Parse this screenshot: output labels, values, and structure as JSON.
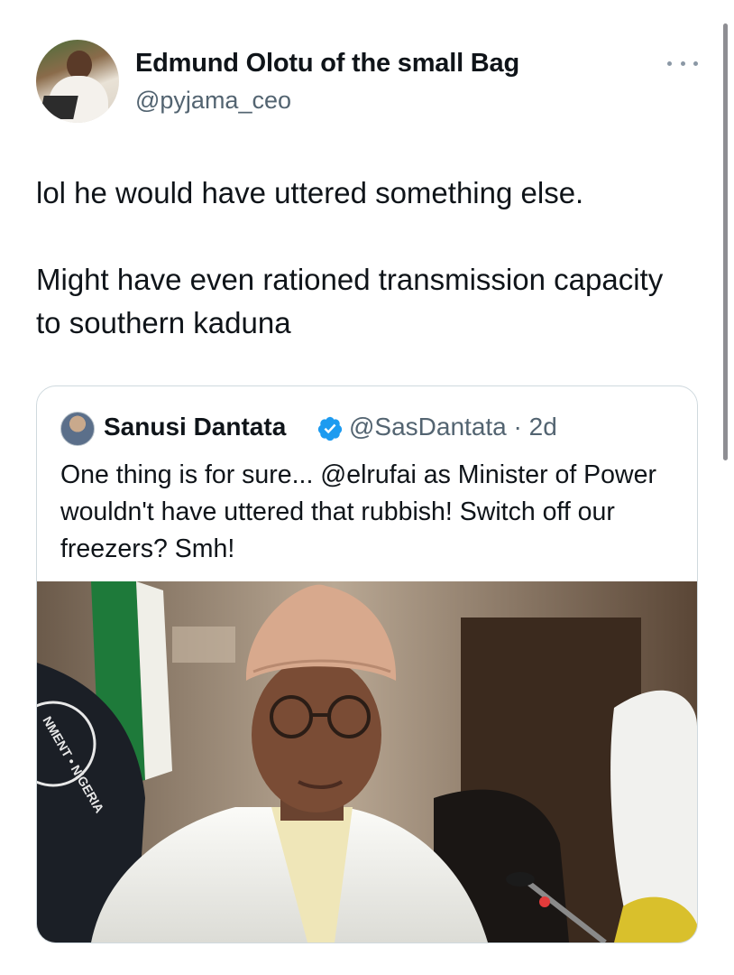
{
  "tweet": {
    "author_name": "Edmund Olotu of the small Bag",
    "author_handle": "@pyjama_ceo",
    "text_line1": "lol he would have uttered something else.",
    "text_line2": "Might have even rationed transmission capacity to southern kaduna",
    "more_icon": "more-horizontal-icon"
  },
  "quoted_tweet": {
    "author_name": "Sanusi Dantata",
    "verified_icon": "verified-badge-icon",
    "verified_color": "#1d9bf0",
    "handle_time": "@SasDantata · 2d",
    "text": "One thing is for sure... @elrufai as Minister of Power wouldn't have uttered that rubbish! Switch off our freezers? Smh!",
    "photo": {
      "seal_text": "NMENT • NIGERIA"
    }
  },
  "colors": {
    "text_primary": "#0f1419",
    "text_secondary": "#536471",
    "border": "#cfd9de"
  }
}
